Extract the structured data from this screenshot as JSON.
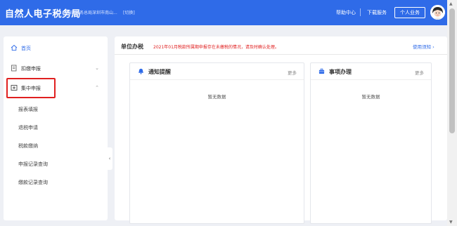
{
  "header": {
    "brand": "自然人电子税务局",
    "org": "国家税务总局深圳市南山...",
    "switch_label": "[切换]",
    "help_label": "帮助中心",
    "download_label": "下载服务",
    "personal_button": "个人业务"
  },
  "sidebar": {
    "items": [
      {
        "label": "首页",
        "icon": "home-icon"
      },
      {
        "label": "扣缴申报",
        "icon": "document-icon"
      },
      {
        "label": "集中申报",
        "icon": "collective-icon"
      }
    ],
    "sub_items": [
      "报表填报",
      "退税申请",
      "税款缴纳",
      "申报记录查询",
      "缴款记录查询"
    ]
  },
  "main": {
    "title": "单位办税",
    "notice": "2021年01月税款所属期申报存在未缴税的情况，请及时确认处理。",
    "link": "使用须知",
    "cards": [
      {
        "title": "通知提醒",
        "more": "更多",
        "empty": "暂无数据",
        "icon": "bell-icon"
      },
      {
        "title": "事项办理",
        "more": "更多",
        "empty": "暂无数据",
        "icon": "briefcase-icon"
      }
    ]
  },
  "colors": {
    "accent": "#2f6be8",
    "alert": "#e02020"
  }
}
